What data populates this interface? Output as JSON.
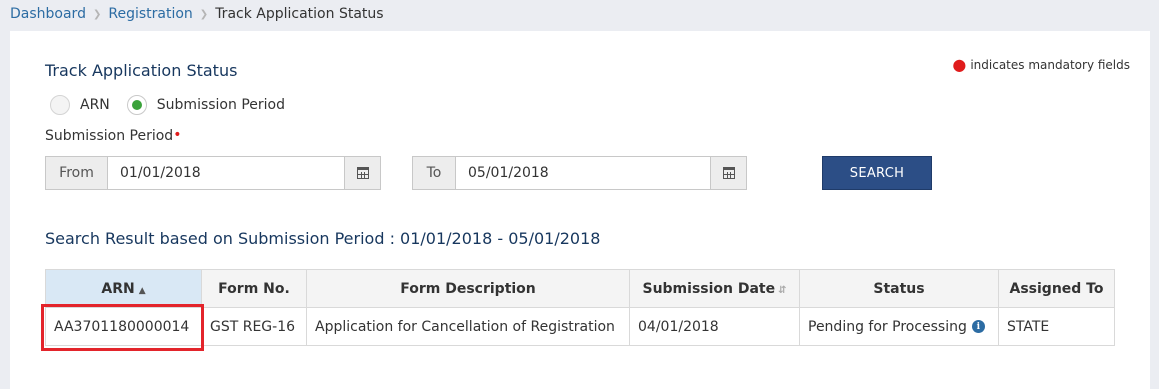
{
  "breadcrumb": {
    "items": [
      "Dashboard",
      "Registration"
    ],
    "current": "Track Application Status"
  },
  "form": {
    "title": "Track Application Status",
    "mandatory_note": "indicates mandatory fields",
    "radio_options": [
      {
        "label": "ARN",
        "checked": false
      },
      {
        "label": "Submission Period",
        "checked": true
      }
    ],
    "period_label": "Submission Period",
    "from": {
      "label": "From",
      "value": "01/01/2018"
    },
    "to": {
      "label": "To",
      "value": "05/01/2018"
    },
    "search_label": "SEARCH"
  },
  "results": {
    "title": "Search Result based on Submission Period : 01/01/2018 - 05/01/2018",
    "columns": [
      "ARN",
      "Form No.",
      "Form Description",
      "Submission Date",
      "Status",
      "Assigned To"
    ],
    "rows": [
      {
        "arn": "AA3701180000014",
        "form_no": "GST REG-16",
        "description": "Application for Cancellation of Registration",
        "date": "04/01/2018",
        "status": "Pending for Processing",
        "assigned": "STATE"
      }
    ]
  },
  "colors": {
    "accent": "#2c4e86",
    "link": "#2c6ca3",
    "radio_checked": "#3aa23a",
    "highlight": "#e3242b",
    "required": "#e01c1c"
  }
}
